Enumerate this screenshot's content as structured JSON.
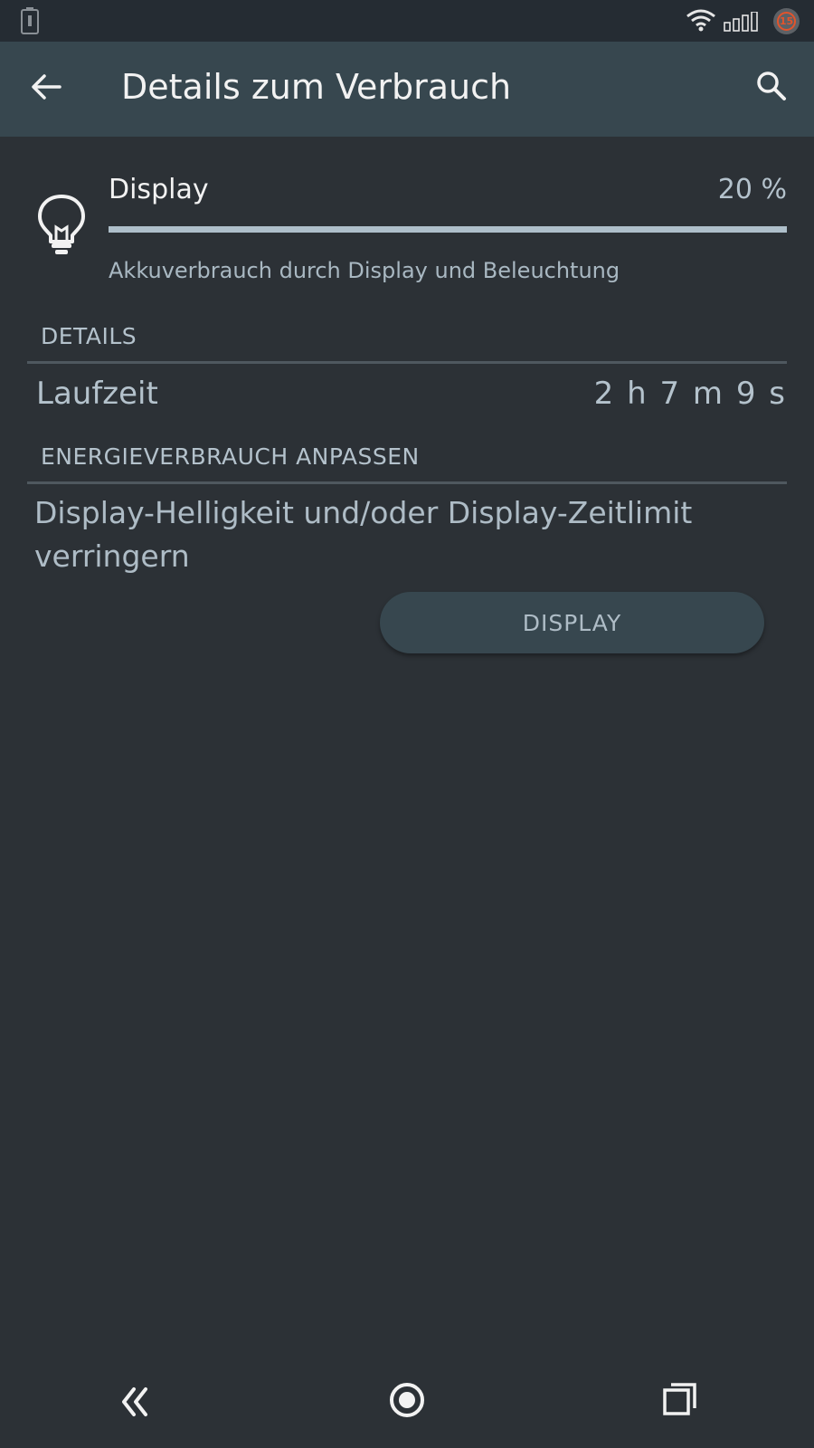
{
  "status_bar": {
    "notification_count": "15",
    "icons": [
      "battery-icon",
      "wifi-icon",
      "signal-icon",
      "notification-badge"
    ]
  },
  "app_bar": {
    "title": "Details zum Verbrauch",
    "back_icon": "arrow-left-icon",
    "search_icon": "search-icon"
  },
  "usage": {
    "icon": "lightbulb-icon",
    "name": "Display",
    "percent": "20 %",
    "bar_fill_fraction": 1.0,
    "description": "Akkuverbrauch durch Display und Beleuchtung"
  },
  "details": {
    "header": "DETAILS",
    "rows": [
      {
        "label": "Laufzeit",
        "value": "2 h 7 m 9 s"
      }
    ]
  },
  "energy": {
    "header": "ENERGIEVERBRAUCH ANPASSEN",
    "advice": "Display-Helligkeit und/oder Display-Zeitlimit verringern",
    "button_label": "DISPLAY"
  },
  "nav_bar": {
    "icons": [
      "nav-back-icon",
      "nav-home-icon",
      "nav-recent-icon"
    ]
  },
  "colors": {
    "background": "#2c3136",
    "app_bar": "#37474f",
    "status_bar": "#252c33",
    "text_primary": "#f2f2f2",
    "text_secondary": "#b4c2cc",
    "badge_accent": "#e2542c"
  }
}
